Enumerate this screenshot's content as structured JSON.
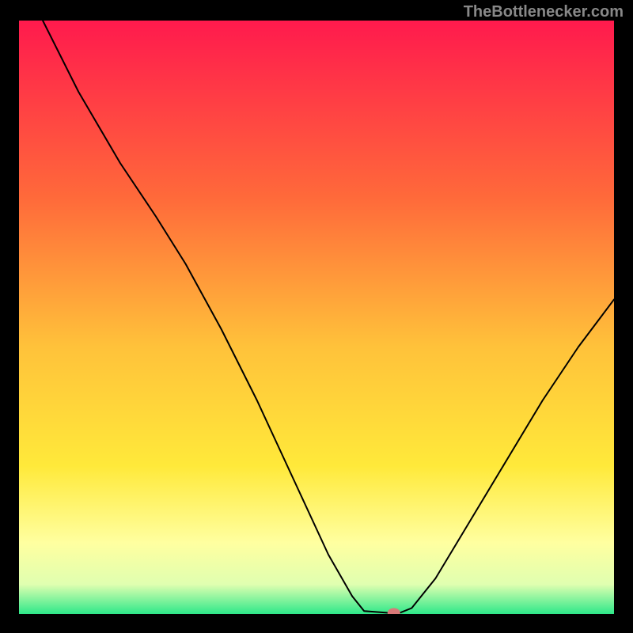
{
  "watermark": "TheBottlenecker.com",
  "chart_data": {
    "type": "line",
    "title": "",
    "xlabel": "",
    "ylabel": "",
    "xlim": [
      0,
      100
    ],
    "ylim": [
      0,
      100
    ],
    "background_gradient": {
      "stops": [
        {
          "offset": 0,
          "color": "#ff1a4d"
        },
        {
          "offset": 30,
          "color": "#ff6a3a"
        },
        {
          "offset": 55,
          "color": "#ffc23a"
        },
        {
          "offset": 75,
          "color": "#ffe93a"
        },
        {
          "offset": 88,
          "color": "#ffffa0"
        },
        {
          "offset": 95,
          "color": "#e0ffb0"
        },
        {
          "offset": 100,
          "color": "#2ee88a"
        }
      ]
    },
    "curve": {
      "color": "#000000",
      "width": 2,
      "points": [
        {
          "x": 4,
          "y": 100
        },
        {
          "x": 10,
          "y": 88
        },
        {
          "x": 17,
          "y": 76
        },
        {
          "x": 23,
          "y": 67
        },
        {
          "x": 28,
          "y": 59
        },
        {
          "x": 34,
          "y": 48
        },
        {
          "x": 40,
          "y": 36
        },
        {
          "x": 46,
          "y": 23
        },
        {
          "x": 52,
          "y": 10
        },
        {
          "x": 56,
          "y": 3
        },
        {
          "x": 58,
          "y": 0.5
        },
        {
          "x": 62,
          "y": 0.2
        },
        {
          "x": 64,
          "y": 0.2
        },
        {
          "x": 66,
          "y": 1
        },
        {
          "x": 70,
          "y": 6
        },
        {
          "x": 76,
          "y": 16
        },
        {
          "x": 82,
          "y": 26
        },
        {
          "x": 88,
          "y": 36
        },
        {
          "x": 94,
          "y": 45
        },
        {
          "x": 100,
          "y": 53
        }
      ]
    },
    "marker": {
      "x": 63,
      "y": 0.2,
      "color": "#d97878",
      "rx": 8,
      "ry": 6
    }
  }
}
